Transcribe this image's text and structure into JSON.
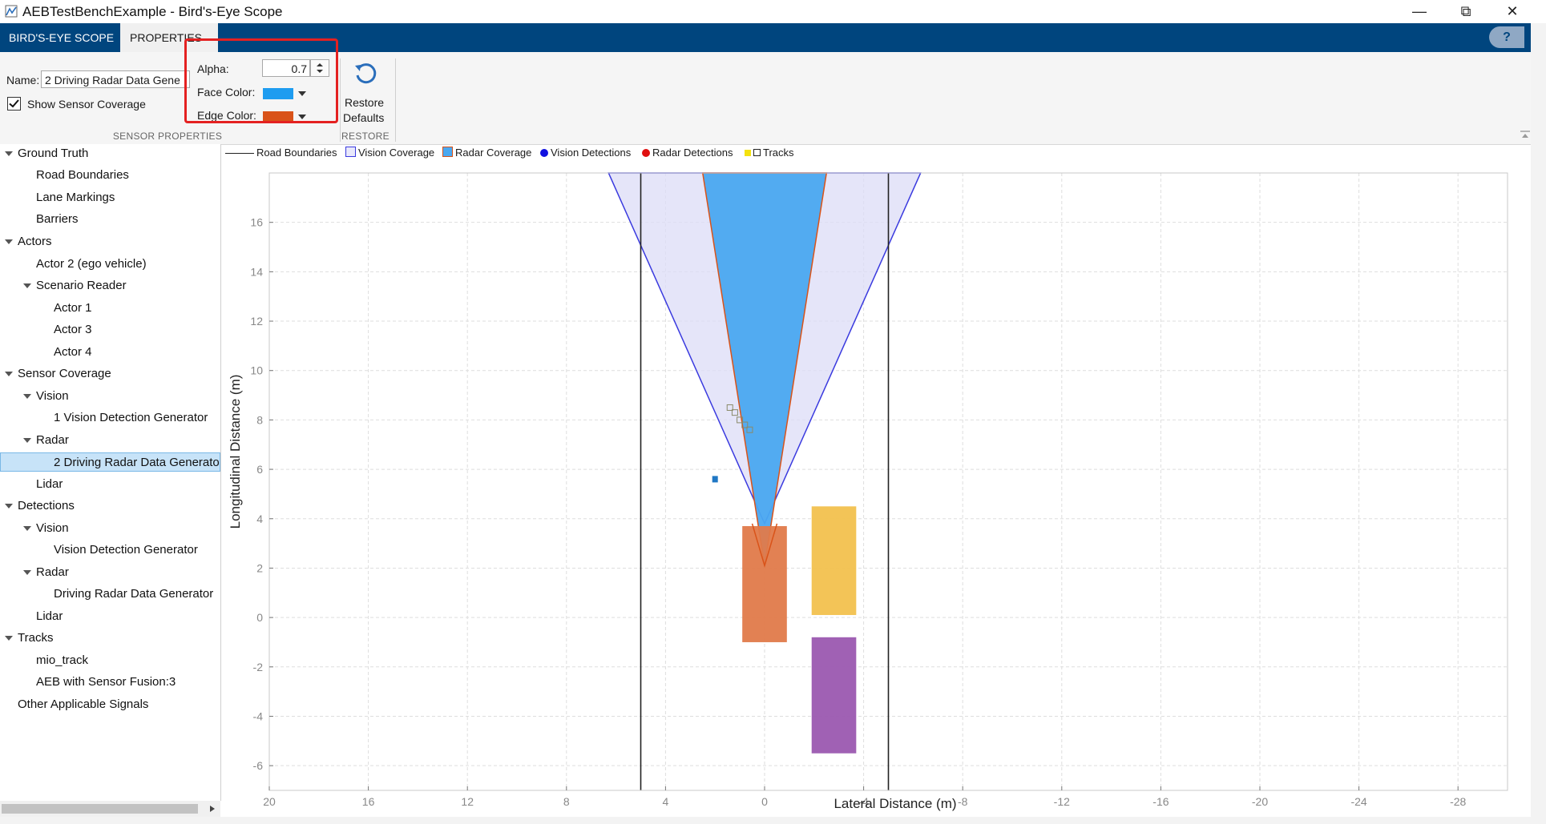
{
  "window": {
    "title": "AEBTestBenchExample - Bird's-Eye Scope",
    "minimize": "—",
    "maximize": "⧉",
    "close": "✕"
  },
  "tabs": [
    {
      "label": "BIRD'S-EYE SCOPE",
      "active": false
    },
    {
      "label": "PROPERTIES",
      "active": true
    }
  ],
  "help_label": "?",
  "sensor_properties": {
    "name_label": "Name:",
    "name_value": "2 Driving Radar Data Gene",
    "show_coverage_label": "Show Sensor Coverage",
    "show_coverage_checked": true,
    "alpha_label": "Alpha:",
    "alpha_value": "0.7",
    "face_color_label": "Face Color:",
    "face_color": "#1e9cf0",
    "edge_color_label": "Edge Color:",
    "edge_color": "#d95319",
    "section_label": "SENSOR PROPERTIES"
  },
  "restore": {
    "button_line1": "Restore",
    "button_line2": "Defaults",
    "section_label": "RESTORE"
  },
  "tree": {
    "ground_truth": "Ground Truth",
    "road_boundaries": "Road Boundaries",
    "lane_markings": "Lane Markings",
    "barriers": "Barriers",
    "actors": "Actors",
    "actor2": "Actor 2 (ego vehicle)",
    "scenario_reader": "Scenario Reader",
    "actor1": "Actor 1",
    "actor3": "Actor 3",
    "actor4": "Actor 4",
    "sensor_coverage": "Sensor Coverage",
    "cov_vision": "Vision",
    "cov_vision_gen": "1 Vision Detection Generator",
    "cov_radar": "Radar",
    "cov_radar_gen": "2 Driving Radar Data Generato",
    "cov_lidar": "Lidar",
    "detections": "Detections",
    "det_vision": "Vision",
    "det_vision_gen": "Vision Detection Generator",
    "det_radar": "Radar",
    "det_radar_gen": "Driving Radar Data Generator",
    "det_lidar": "Lidar",
    "tracks": "Tracks",
    "mio_track": "mio_track",
    "aeb_fusion": "AEB with Sensor Fusion:3",
    "other_signals": "Other Applicable Signals"
  },
  "legend": {
    "road_boundaries": "Road Boundaries",
    "vision_coverage": "Vision Coverage",
    "radar_coverage": "Radar Coverage",
    "vision_detections": "Vision Detections",
    "radar_detections": "Radar Detections",
    "tracks": "Tracks"
  },
  "chart_data": {
    "type": "scatter",
    "xlabel": "Lateral Distance (m)",
    "ylabel": "Longitudinal Distance (m)",
    "xlim": [
      20,
      -30
    ],
    "ylim": [
      -7,
      18
    ],
    "x_reversed": true,
    "xticks": [
      20,
      16,
      12,
      8,
      4,
      0,
      -4,
      -8,
      -12,
      -16,
      -20,
      -24,
      -28
    ],
    "yticks": [
      -6,
      -4,
      -2,
      0,
      2,
      4,
      6,
      8,
      10,
      12,
      14,
      16
    ],
    "grid": true,
    "road_boundaries": [
      {
        "x": 5,
        "y": [
          -7,
          18
        ]
      },
      {
        "x": -5,
        "y": [
          -7,
          18
        ]
      }
    ],
    "vision_coverage": {
      "origin": [
        0,
        3.8
      ],
      "left_edge_at_top": [
        6.3,
        18
      ],
      "right_edge_at_top": [
        -6.3,
        18
      ],
      "color": "#dcdcf7",
      "edge": "#3a3adf"
    },
    "radar_coverage": {
      "origin": [
        0,
        2.1
      ],
      "left_edge_at_top": [
        2.5,
        18
      ],
      "right_edge_at_top": [
        -2.5,
        18
      ],
      "color": "#4aa8f0",
      "edge": "#d95319"
    },
    "actors": [
      {
        "name": "ego",
        "x": [
          0.9,
          -0.9
        ],
        "y": [
          -1.0,
          3.7
        ],
        "color": "#e07a4a"
      },
      {
        "name": "yellow",
        "x": [
          -1.9,
          -3.7
        ],
        "y": [
          0.1,
          4.5
        ],
        "color": "#f2c14e"
      },
      {
        "name": "purple",
        "x": [
          -1.9,
          -3.7
        ],
        "y": [
          -5.5,
          -0.8
        ],
        "color": "#9b59b0"
      }
    ],
    "radar_detection_points": [
      {
        "x": 2.0,
        "y": 5.6
      }
    ],
    "tracks": [
      {
        "x": 1.4,
        "y": 8.5
      },
      {
        "x": 1.2,
        "y": 8.3
      },
      {
        "x": 1.0,
        "y": 8.0
      },
      {
        "x": 0.8,
        "y": 7.8
      },
      {
        "x": 0.6,
        "y": 7.6
      }
    ]
  }
}
